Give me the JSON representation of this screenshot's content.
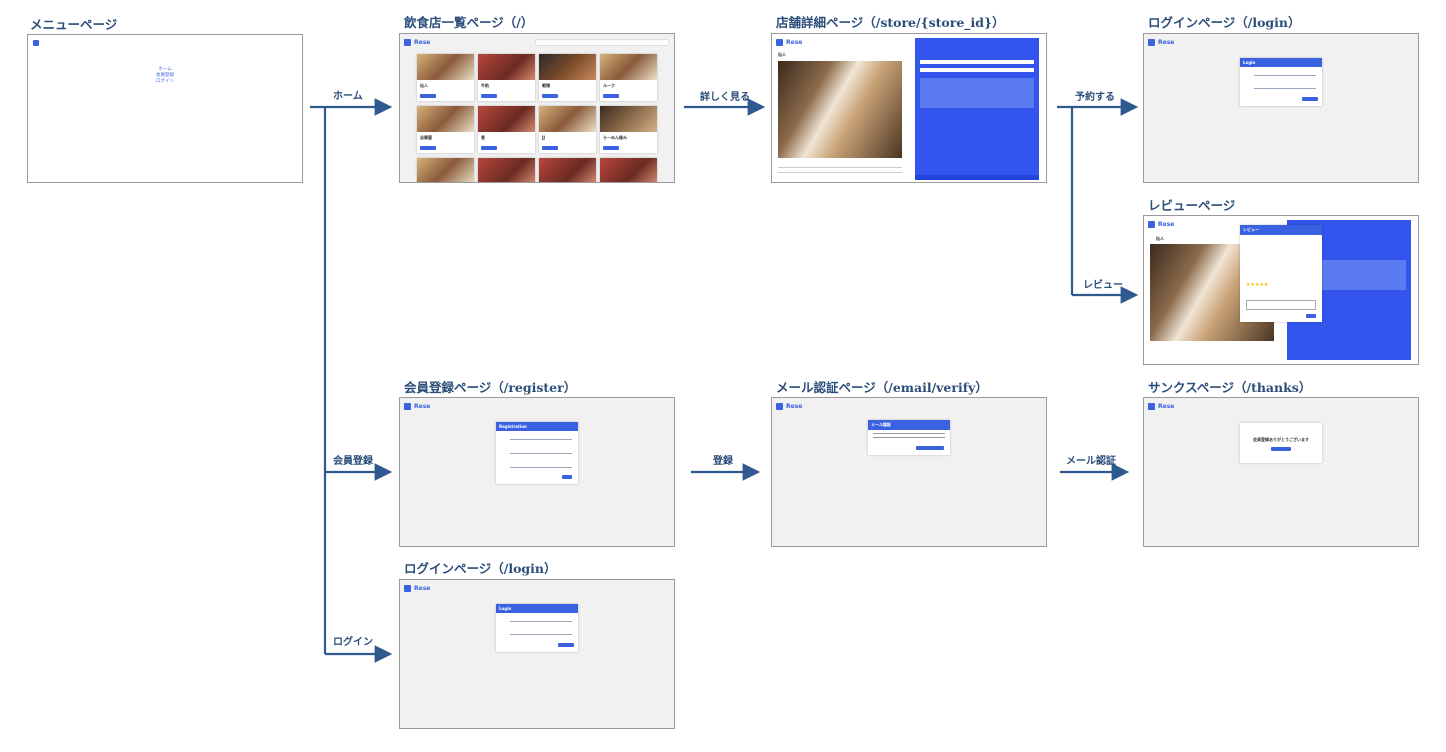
{
  "pages": {
    "menu": {
      "title": "メニューページ",
      "links": [
        "ホーム",
        "会員登録",
        "ログイン"
      ]
    },
    "shop_list": {
      "title": "飲食店一覧ページ（/）",
      "brand": "Rese",
      "shops": [
        "仙人",
        "牛助",
        "戦慄",
        "ルーク",
        "志摩屋",
        "香",
        "JJ",
        "らーめん極み"
      ]
    },
    "shop_detail": {
      "title": "店舗詳細ページ（/store/{store_id}）",
      "brand": "Rese",
      "shop": "仙人"
    },
    "login_a": {
      "title": "ログインページ（/login）",
      "brand": "Rese",
      "card": "Login"
    },
    "review": {
      "title": "レビューページ",
      "brand": "Rese",
      "shop": "仙人",
      "card": "レビュー"
    },
    "register": {
      "title": "会員登録ページ（/register）",
      "brand": "Rese",
      "card": "Registration"
    },
    "verify": {
      "title": "メール認証ページ（/email/verify）",
      "brand": "Rese",
      "card": "メール認証"
    },
    "thanks": {
      "title": "サンクスページ（/thanks）",
      "brand": "Rese",
      "message": "会員登録ありがとうございます"
    },
    "login_b": {
      "title": "ログインページ（/login）",
      "brand": "Rese",
      "card": "Login"
    }
  },
  "edges": {
    "home": "ホーム",
    "register": "会員登録",
    "login": "ログイン",
    "details": "詳しく見る",
    "reserve": "予約する",
    "review": "レビュー",
    "signup": "登録",
    "mail_verify": "メール認証"
  },
  "colors": {
    "arrow": "#2f5a8f",
    "accent": "#3a62e0",
    "panel_bg": "#f1f1f1"
  }
}
